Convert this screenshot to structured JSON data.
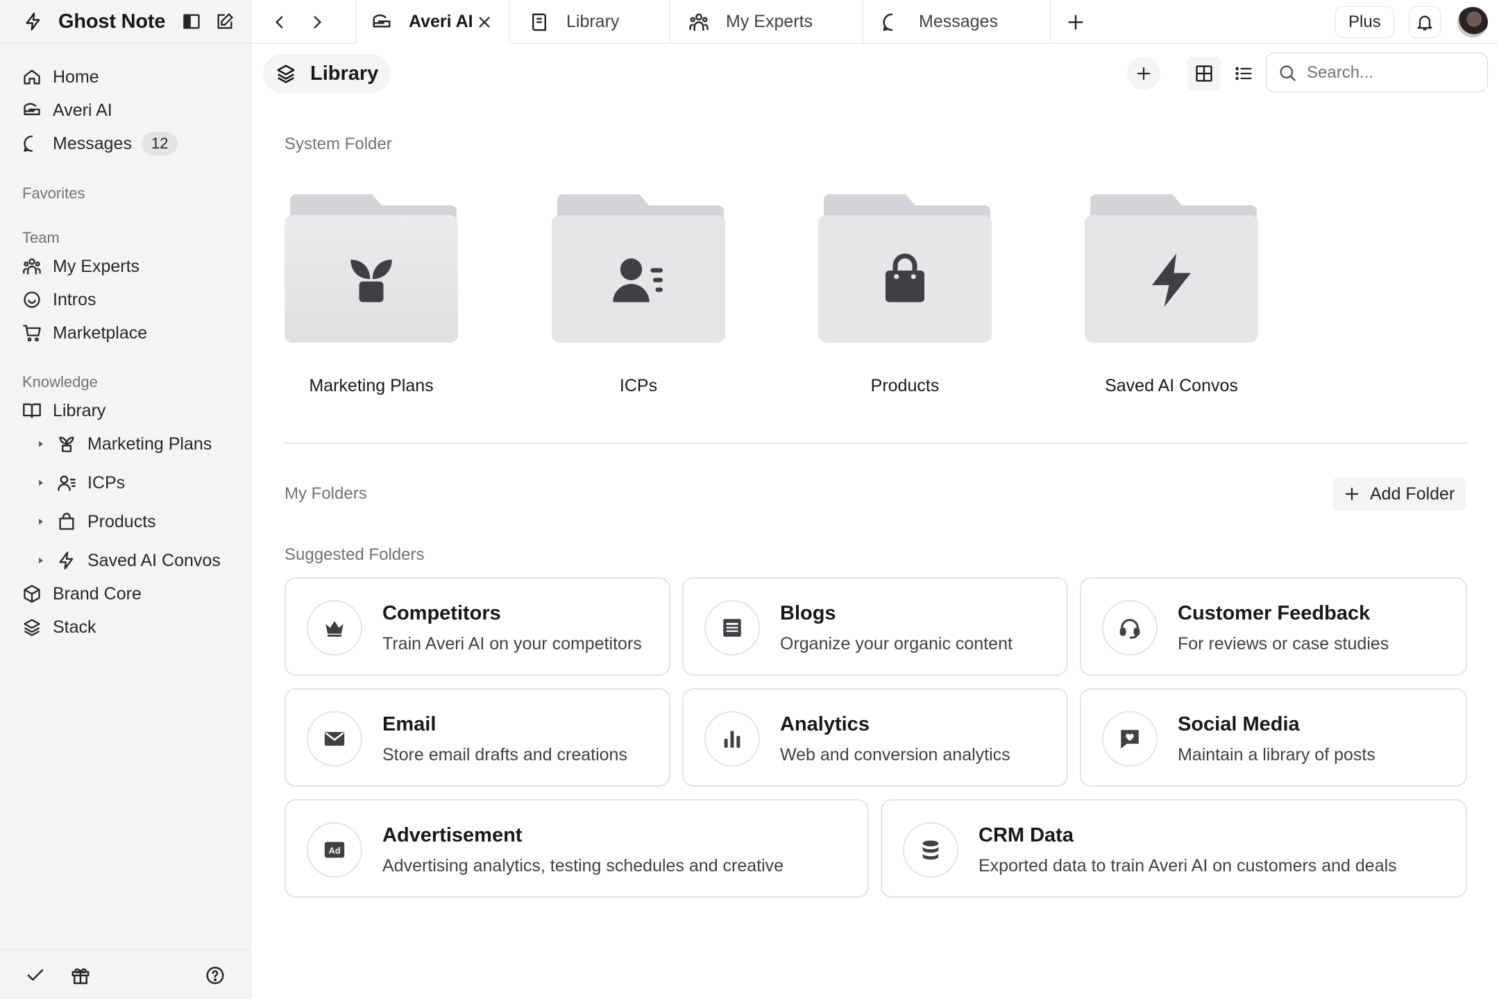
{
  "app": {
    "name": "Ghost Note"
  },
  "tabs": [
    {
      "label": "Averi AI",
      "icon": "averi-icon",
      "active": true
    },
    {
      "label": "Library",
      "icon": "book-icon"
    },
    {
      "label": "My Experts",
      "icon": "people-icon"
    },
    {
      "label": "Messages",
      "icon": "chat-icon"
    }
  ],
  "topbar": {
    "plan_label": "Plus"
  },
  "sidebar": {
    "items": [
      {
        "label": "Home",
        "icon": "home-icon"
      },
      {
        "label": "Averi AI",
        "icon": "averi-icon"
      },
      {
        "label": "Messages",
        "icon": "chat-icon",
        "badge": "12"
      }
    ],
    "favorites_label": "Favorites",
    "team_label": "Team",
    "team_items": [
      {
        "label": "My Experts",
        "icon": "people-icon"
      },
      {
        "label": "Intros",
        "icon": "smile-icon"
      },
      {
        "label": "Marketplace",
        "icon": "cart-icon"
      }
    ],
    "knowledge_label": "Knowledge",
    "library_label": "Library",
    "library_children": [
      {
        "label": "Marketing Plans",
        "icon": "sprout-icon"
      },
      {
        "label": "ICPs",
        "icon": "user-list-icon"
      },
      {
        "label": "Products",
        "icon": "shopping-bag-icon"
      },
      {
        "label": "Saved AI Convos",
        "icon": "bolt-icon"
      }
    ],
    "knowledge_items": [
      {
        "label": "Brand Core",
        "icon": "cube-icon"
      },
      {
        "label": "Stack",
        "icon": "layers-icon"
      }
    ]
  },
  "main": {
    "breadcrumb": "Library",
    "search_placeholder": "Search...",
    "system_folder_label": "System Folder",
    "system_folders": [
      {
        "name": "Marketing Plans",
        "icon": "sprout-icon"
      },
      {
        "name": "ICPs",
        "icon": "user-list-icon"
      },
      {
        "name": "Products",
        "icon": "shopping-bag-icon"
      },
      {
        "name": "Saved AI Convos",
        "icon": "bolt-icon"
      }
    ],
    "my_folders_label": "My Folders",
    "add_folder_label": "Add Folder",
    "suggested_label": "Suggested Folders",
    "suggested": [
      {
        "title": "Competitors",
        "desc": "Train Averi AI on your competitors",
        "icon": "crown-icon"
      },
      {
        "title": "Blogs",
        "desc": "Organize your organic content",
        "icon": "article-icon"
      },
      {
        "title": "Customer Feedback",
        "desc": "For reviews or case studies",
        "icon": "headset-icon"
      },
      {
        "title": "Email",
        "desc": "Store email drafts and creations",
        "icon": "mail-icon"
      },
      {
        "title": "Analytics",
        "desc": "Web and conversion analytics",
        "icon": "bar-chart-icon"
      },
      {
        "title": "Social Media",
        "desc": "Maintain a library of posts",
        "icon": "heart-message-icon"
      },
      {
        "title": "Advertisement",
        "desc": "Advertising analytics, testing schedules and creative",
        "icon": "ad-icon"
      },
      {
        "title": "CRM Data",
        "desc": "Exported data to train Averi AI on customers and deals",
        "icon": "database-icon"
      }
    ]
  },
  "colors": {
    "sidebar_bg": "#f4f4f5",
    "border": "#e4e4e7",
    "text": "#18181b",
    "muted": "#71717a",
    "folder_icon": "#3f3f46"
  }
}
